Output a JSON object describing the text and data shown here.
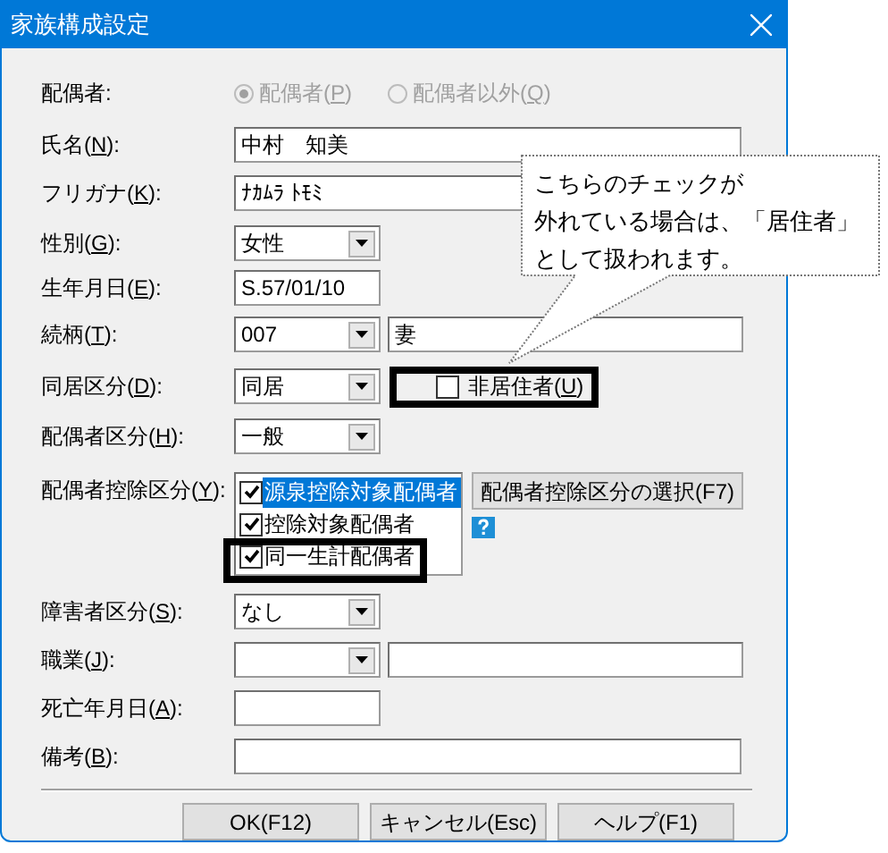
{
  "window": {
    "title": "家族構成設定"
  },
  "spouse": {
    "label": "配偶者:",
    "disabled": true,
    "options": [
      {
        "label": "配偶者(P)",
        "selected": true
      },
      {
        "label": "配偶者以外(Q)",
        "selected": false
      }
    ]
  },
  "rows": [
    {
      "kind": "text",
      "label": "氏名(N):",
      "value": "中村　知美"
    },
    {
      "kind": "text",
      "label": "フリガナ(K):",
      "value": "ﾅｶﾑﾗ ﾄﾓﾐ"
    },
    {
      "kind": "combo",
      "label": "性別(G):",
      "value": "女性"
    },
    {
      "kind": "date",
      "label": "生年月日(E):",
      "value": "S.57/01/10"
    },
    {
      "kind": "combo_text",
      "label": "続柄(T):",
      "value": "007",
      "text": "妻"
    },
    {
      "kind": "combo_check",
      "label": "同居区分(D):",
      "value": "同居",
      "check": {
        "label": "非居住者(U)",
        "checked": false,
        "highlighted": true
      }
    },
    {
      "kind": "combo",
      "label": "配偶者区分(H):",
      "value": "一般"
    },
    {
      "kind": "checklist",
      "label": "配偶者控除区分(Y):",
      "button": "配偶者控除区分の選択(F7)",
      "items": [
        {
          "label": "源泉控除対象配偶者",
          "checked": true,
          "selected": true,
          "highlighted": false
        },
        {
          "label": "控除対象配偶者",
          "checked": true,
          "selected": false,
          "highlighted": false
        },
        {
          "label": "同一生計配偶者",
          "checked": true,
          "selected": false,
          "highlighted": true
        }
      ]
    },
    {
      "kind": "combo",
      "label": "障害者区分(S):",
      "value": "なし"
    },
    {
      "kind": "combo_text",
      "label": "職業(J):"
    },
    {
      "kind": "date",
      "label": "死亡年月日(A):"
    },
    {
      "kind": "text",
      "label": "備考(B):"
    }
  ],
  "buttons": [
    "OK(F12)",
    "キャンセル(Esc)",
    "ヘルプ(F1)"
  ],
  "callout": {
    "lines": [
      "こちらのチェックが",
      "外れている場合は、「居住者」",
      "として扱われます。"
    ]
  }
}
